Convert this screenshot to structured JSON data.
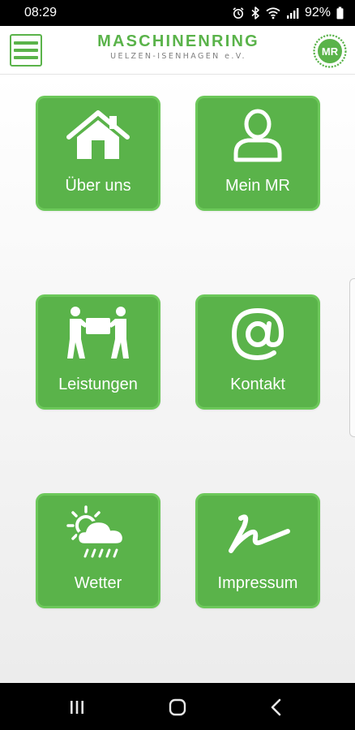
{
  "status_bar": {
    "time": "08:29",
    "battery_percent": "92%",
    "icons": [
      "alarm-icon",
      "bluetooth-icon",
      "wifi-icon",
      "signal-icon",
      "battery-icon"
    ]
  },
  "header": {
    "title": "MASCHINENRING",
    "subtitle": "UELZEN-ISENHAGEN e.V.",
    "logo_text": "MR",
    "menu_icon": "hamburger-menu-icon"
  },
  "colors": {
    "brand_green": "#5ab34a",
    "tile_border": "#6cc85a",
    "subtitle_gray": "#7f7f7f"
  },
  "tiles": [
    {
      "label": "Über uns",
      "icon": "house-icon"
    },
    {
      "label": "Mein MR",
      "icon": "person-icon"
    },
    {
      "label": "Leistungen",
      "icon": "people-carrying-box-icon"
    },
    {
      "label": "Kontakt",
      "icon": "at-sign-icon"
    },
    {
      "label": "Wetter",
      "icon": "sun-cloud-rain-icon"
    },
    {
      "label": "Impressum",
      "icon": "signature-icon"
    }
  ],
  "nav_bar": {
    "buttons": [
      "recent-apps-icon",
      "home-icon",
      "back-icon"
    ]
  }
}
